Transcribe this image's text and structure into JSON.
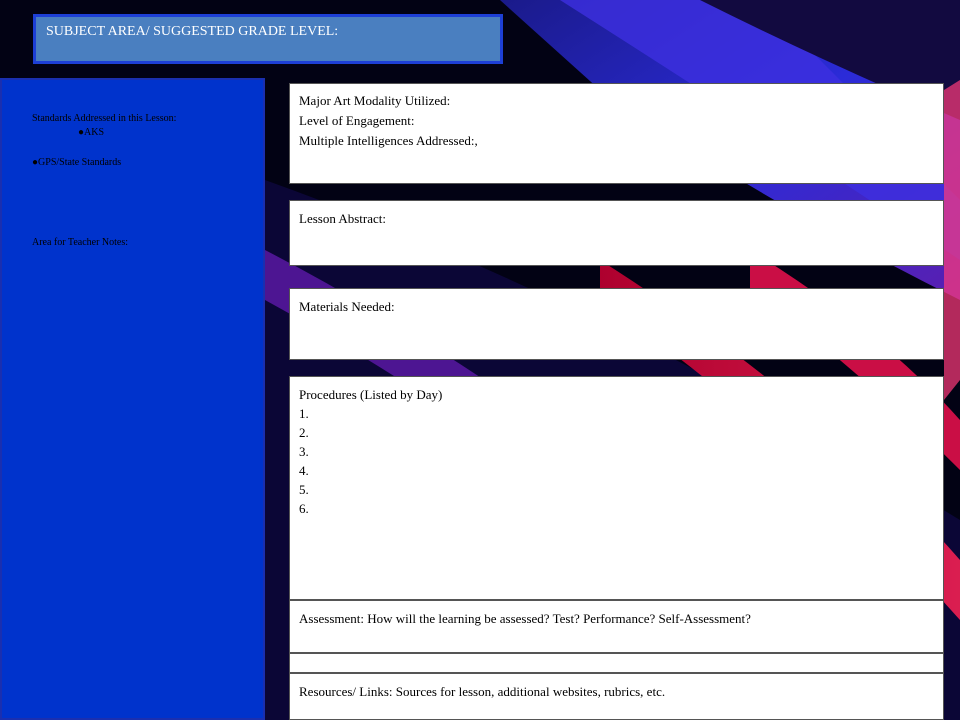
{
  "title": "SUBJECT AREA/ SUGGESTED GRADE LEVEL:",
  "sidebar": {
    "standards_label": "Standards Addressed in this Lesson:",
    "bullet_aks": "AKS",
    "bullet_gps": "GPS/State Standards",
    "teacher_notes_label": "Area for Teacher Notes:"
  },
  "modality_box": {
    "line1": "Major Art Modality Utilized:",
    "line2": "Level of Engagement:",
    "line3": "Multiple Intelligences Addressed:,"
  },
  "abstract_label": "Lesson Abstract:",
  "materials_label": "Materials Needed:",
  "procedures": {
    "title": "Procedures (Listed by Day)",
    "steps": [
      "1.",
      "2.",
      "3.",
      "4.",
      "5.",
      "6."
    ]
  },
  "assessment_label": "Assessment:  How will the learning be assessed? Test? Performance? Self-Assessment?",
  "resources_label": "Resources/ Links: Sources for lesson, additional websites, rubrics, etc.",
  "colors": {
    "title_bg": "#4a7fc0",
    "sidebar_bg": "#0033cc",
    "background": "#000000"
  }
}
